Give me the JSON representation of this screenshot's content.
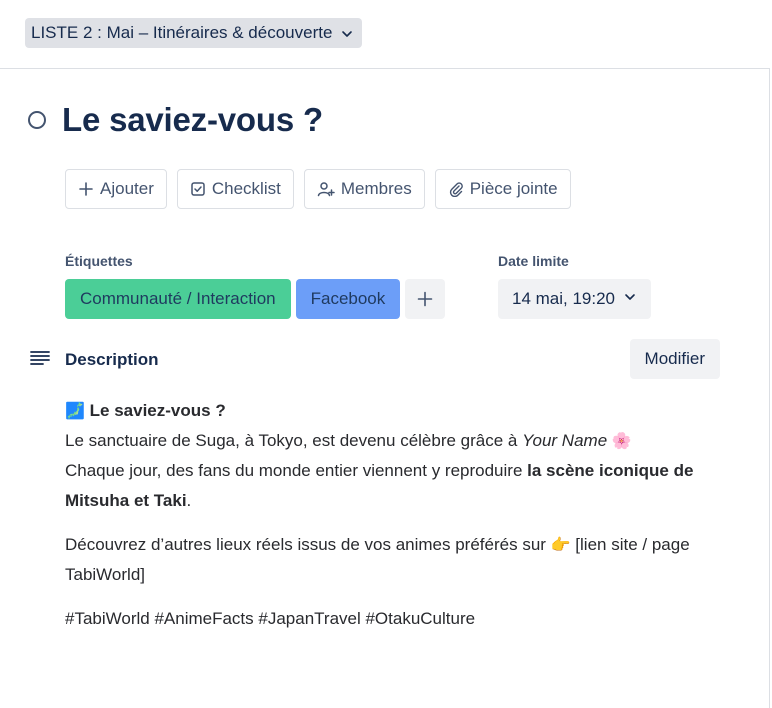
{
  "list_selector": {
    "label": "LISTE 2 : Mai – Itinéraires & découverte",
    "icon": "chevron-down-icon"
  },
  "card": {
    "title": "Le saviez-vous ?",
    "status_icon": "circle-outline-icon"
  },
  "actions": [
    {
      "label": "Ajouter",
      "icon": "plus-icon"
    },
    {
      "label": "Checklist",
      "icon": "checkbox-icon"
    },
    {
      "label": "Membres",
      "icon": "add-member-icon"
    },
    {
      "label": "Pièce jointe",
      "icon": "paperclip-icon"
    }
  ],
  "labels_section": {
    "heading": "Étiquettes",
    "labels": [
      {
        "text": "Communauté / Interaction",
        "color": "#4bce97"
      },
      {
        "text": "Facebook",
        "color": "#6c9ef8"
      }
    ],
    "add_label": "+"
  },
  "due_section": {
    "heading": "Date limite",
    "value": "14 mai, 19:20"
  },
  "description": {
    "heading": "Description",
    "edit_label": "Modifier",
    "heading_emoji": "🗾",
    "heading_text": "Le saviez-vous ?",
    "line1_prefix": "Le sanctuaire de Suga, à Tokyo, est devenu célèbre grâce à ",
    "line1_italic": "Your Name",
    "line1_emoji": "🌸",
    "line2_prefix": "Chaque jour, des fans du monde entier viennent y reproduire ",
    "line2_bold": "la scène iconique de Mitsuha et Taki",
    "line2_suffix": ".",
    "para2_prefix": "Découvrez d’autres lieux réels issus de vos animes préférés sur ",
    "para2_emoji": "👉",
    "para2_suffix": " [lien site / page TabiWorld]",
    "hashtags": "#TabiWorld #AnimeFacts #JapanTravel #OtakuCulture"
  }
}
